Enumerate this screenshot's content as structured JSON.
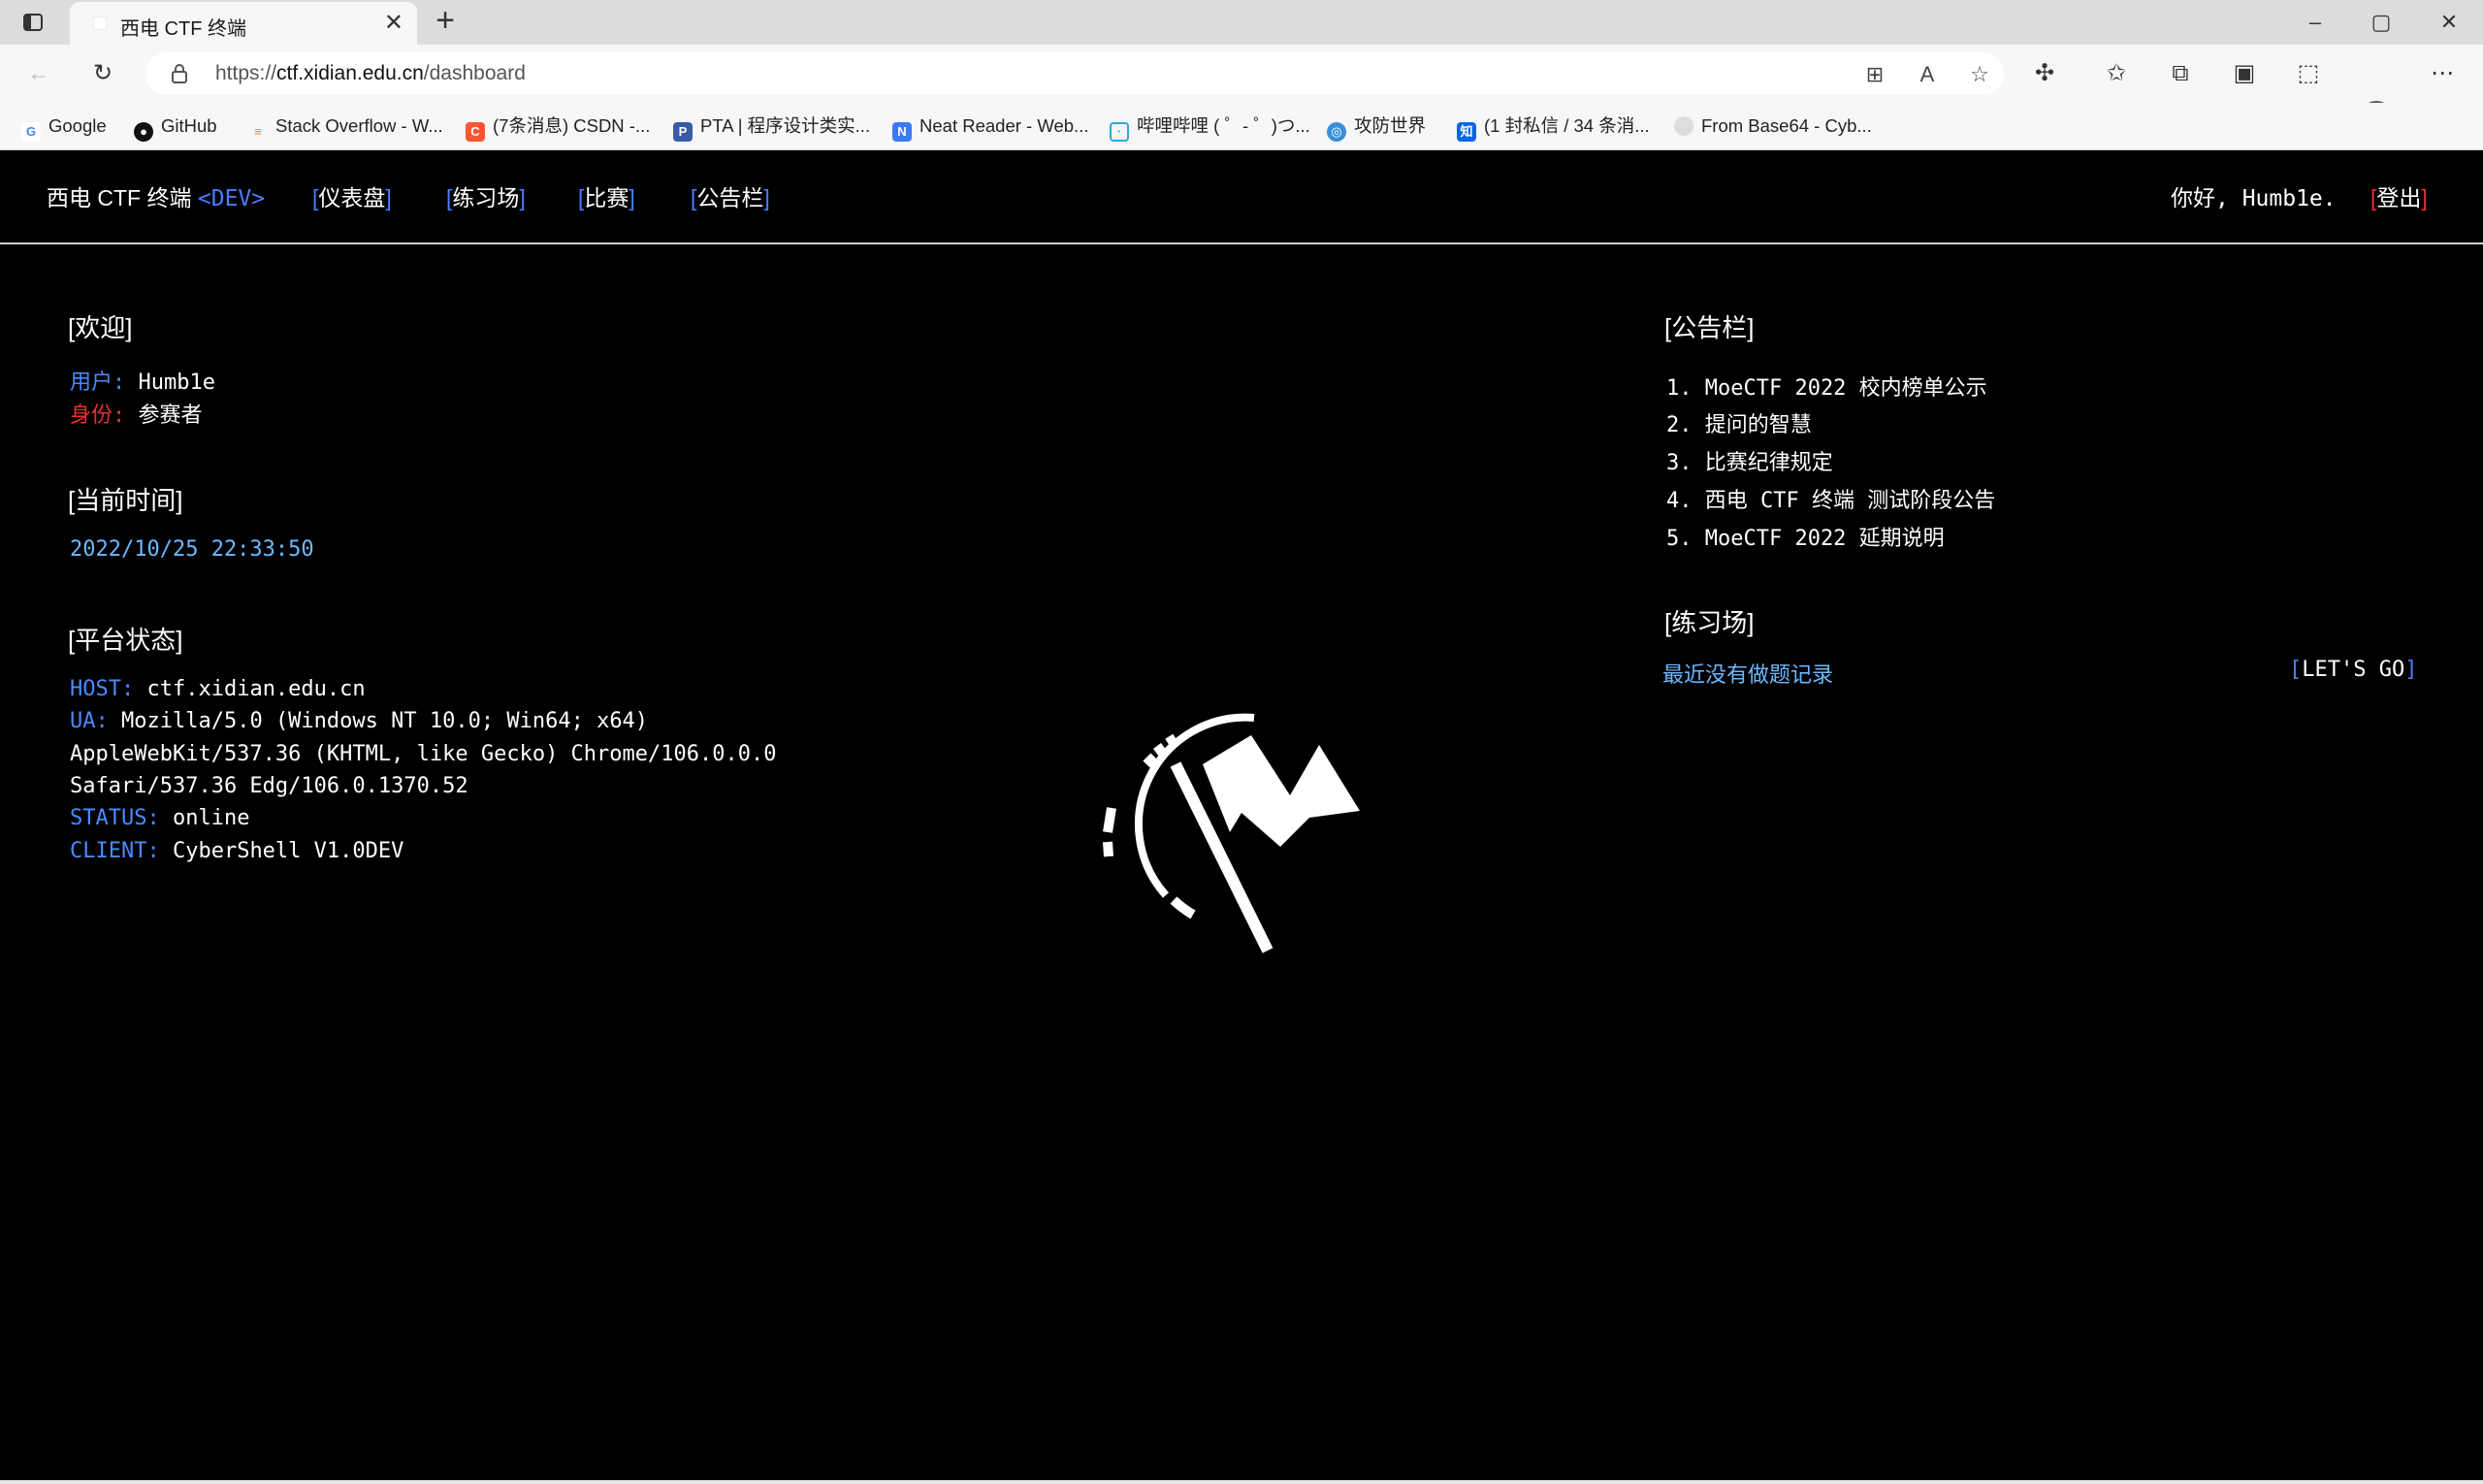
{
  "browser": {
    "tab_title": "西电 CTF 终端",
    "tab_close": "✕",
    "url_scheme": "https://",
    "url_host": "ctf.xidian.edu.cn",
    "url_path": "/dashboard",
    "bookmarks": [
      {
        "label": "Google",
        "icon": "google-icon",
        "color": "#4285f4"
      },
      {
        "label": "GitHub",
        "icon": "github-icon",
        "color": "#111111"
      },
      {
        "label": "Stack Overflow - W...",
        "icon": "stackoverflow-icon",
        "color": "#f48024"
      },
      {
        "label": "(7条消息) CSDN -...",
        "icon": "csdn-icon",
        "color": "#fc5531"
      },
      {
        "label": "PTA | 程序设计类实...",
        "icon": "pta-icon",
        "color": "#3a5aa8"
      },
      {
        "label": "Neat Reader - Web...",
        "icon": "neatreader-icon",
        "color": "#3b7cf5"
      },
      {
        "label": "哔哩哔哩 ( ゜- ゜)つ...",
        "icon": "bilibili-icon",
        "color": "#2fa7e0"
      },
      {
        "label": "攻防世界",
        "icon": "adworld-icon",
        "color": "#3a8fd8"
      },
      {
        "label": "(1 封私信 / 34 条消...",
        "icon": "zhihu-icon",
        "color": "#0a66e4"
      },
      {
        "label": "From Base64 - Cyb...",
        "icon": "cyberchef-icon",
        "color": "#bbbbbb"
      }
    ]
  },
  "header": {
    "brand": "西电 CTF 终端",
    "brand_tag": "<DEV>",
    "nav": [
      {
        "label": "仪表盘"
      },
      {
        "label": "练习场"
      },
      {
        "label": "比赛"
      },
      {
        "label": "公告栏"
      }
    ],
    "greeting": "你好, Humb1e.",
    "logout": "登出"
  },
  "welcome": {
    "title": "[欢迎]",
    "user_label": "用户:",
    "user_value": "Humb1e",
    "role_label": "身份:",
    "role_value": "参赛者"
  },
  "clock": {
    "title": "[当前时间]",
    "value": "2022/10/25 22:33:50"
  },
  "platform": {
    "title": "[平台状态]",
    "host_label": "HOST:",
    "host_value": "ctf.xidian.edu.cn",
    "ua_label": "UA:",
    "ua_value_1": "Mozilla/5.0 (Windows NT 10.0; Win64; x64)",
    "ua_value_2": "AppleWebKit/537.36 (KHTML, like Gecko) Chrome/106.0.0.0",
    "ua_value_3": "Safari/537.36 Edg/106.0.1370.52",
    "status_label": "STATUS:",
    "status_value": "online",
    "client_label": "CLIENT:",
    "client_value": "CyberShell V1.0DEV"
  },
  "announcements": {
    "title": "[公告栏]",
    "items": [
      "1. MoeCTF 2022 校内榜单公示",
      "2. 提问的智慧",
      "3. 比赛纪律规定",
      "4. 西电 CTF 终端 测试阶段公告",
      "5. MoeCTF 2022 延期说明"
    ]
  },
  "practice": {
    "title": "[练习场]",
    "empty": "最近没有做题记录",
    "cta": "LET'S GO"
  },
  "colors": {
    "accent_blue": "#4a7dff",
    "accent_red": "#e83030",
    "time_blue": "#6cb8ff",
    "background": "#000000"
  }
}
